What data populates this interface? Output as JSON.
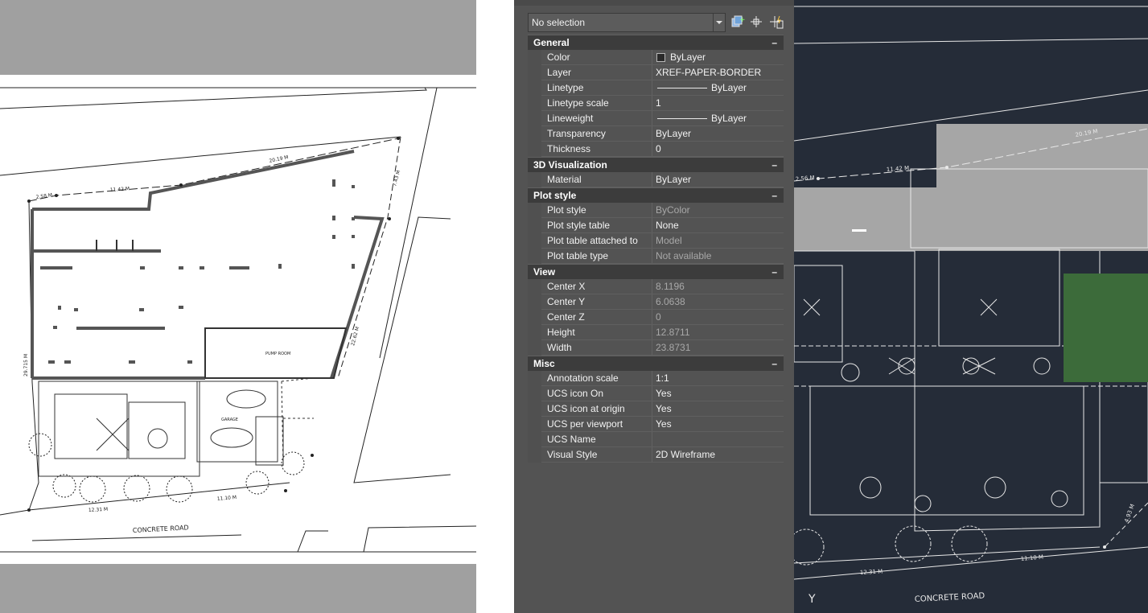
{
  "paper": {
    "labels": {
      "concrete_road": "CONCRETE ROAD",
      "dim_a": "20.19 M",
      "dim_b": "11.42 M",
      "dim_c": "2.58 M",
      "dim_d": "7.43 M",
      "dim_e": "22.62 M",
      "dim_f": "29.715 M",
      "dim_g": "12.31 M",
      "dim_h": "11.10 M",
      "pump_room": "PUMP ROOM",
      "garage": "GARAGE"
    }
  },
  "properties": {
    "selection": "No selection",
    "sections": [
      {
        "title": "General",
        "toggle": "–",
        "rows": [
          {
            "label": "Color",
            "value": "ByLayer"
          },
          {
            "label": "Layer",
            "value": "XREF-PAPER-BORDER"
          },
          {
            "label": "Linetype",
            "value": "ByLayer"
          },
          {
            "label": "Linetype scale",
            "value": "1"
          },
          {
            "label": "Lineweight",
            "value": "ByLayer"
          },
          {
            "label": "Transparency",
            "value": "ByLayer"
          },
          {
            "label": "Thickness",
            "value": "0"
          }
        ]
      },
      {
        "title": "3D Visualization",
        "toggle": "–",
        "rows": [
          {
            "label": "Material",
            "value": "ByLayer"
          }
        ]
      },
      {
        "title": "Plot style",
        "toggle": "–",
        "rows": [
          {
            "label": "Plot style",
            "value": "ByColor"
          },
          {
            "label": "Plot style table",
            "value": "None"
          },
          {
            "label": "Plot table attached to",
            "value": "Model"
          },
          {
            "label": "Plot table type",
            "value": "Not available"
          }
        ]
      },
      {
        "title": "View",
        "toggle": "–",
        "rows": [
          {
            "label": "Center X",
            "value": "8.1196"
          },
          {
            "label": "Center Y",
            "value": "6.0638"
          },
          {
            "label": "Center Z",
            "value": "0"
          },
          {
            "label": "Height",
            "value": "12.8711"
          },
          {
            "label": "Width",
            "value": "23.8731"
          }
        ]
      },
      {
        "title": "Misc",
        "toggle": "–",
        "rows": [
          {
            "label": "Annotation scale",
            "value": "1:1"
          },
          {
            "label": "UCS icon On",
            "value": "Yes"
          },
          {
            "label": "UCS icon at origin",
            "value": "Yes"
          },
          {
            "label": "UCS per viewport",
            "value": "Yes"
          },
          {
            "label": "UCS Name",
            "value": ""
          },
          {
            "label": "Visual Style",
            "value": "2D Wireframe"
          }
        ]
      }
    ]
  },
  "model": {
    "labels": {
      "concrete_road": "CONCRETE ROAD",
      "dim_a": "20.19 M",
      "dim_b": "11.42 M",
      "dim_c": "2.56 M",
      "dim_g": "12.31 M",
      "dim_h": "11.10 M",
      "dim_i": "4.93 M",
      "ucs_y": "Y"
    }
  }
}
